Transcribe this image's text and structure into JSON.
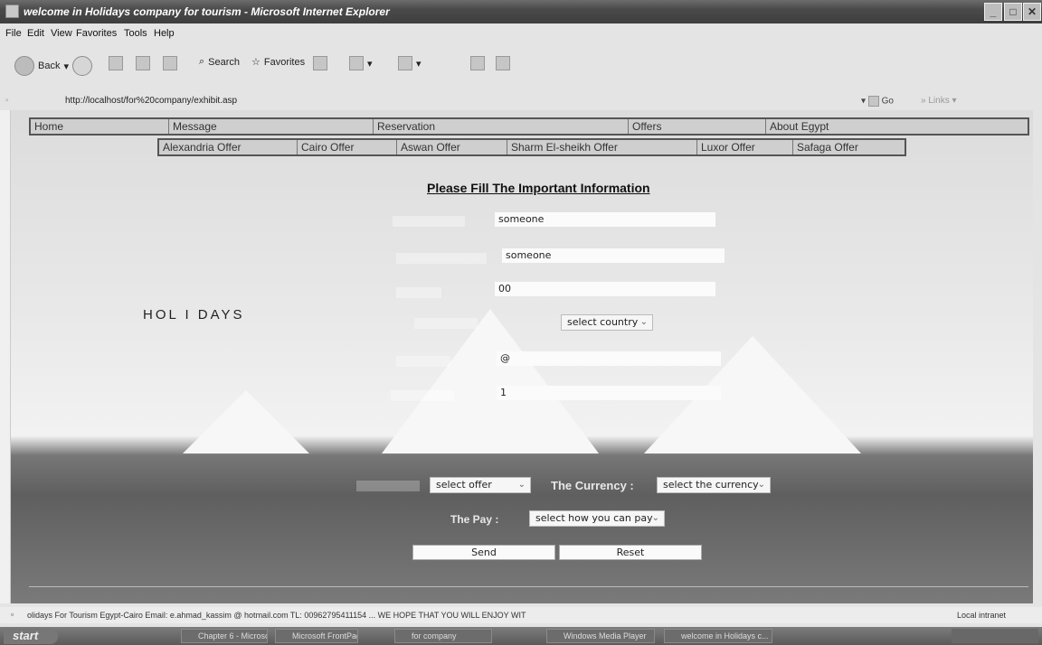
{
  "window": {
    "title": "welcome in Holidays company for tourism - Microsoft Internet Explorer"
  },
  "menu": [
    "File",
    "Edit",
    "View",
    "Favorites",
    "Tools",
    "Help"
  ],
  "toolbar": {
    "back": "Back",
    "search": "Search",
    "favorites": "Favorites"
  },
  "address": {
    "url": "http://localhost/for%20company/exhibit.asp",
    "go": "Go",
    "links": "Links"
  },
  "nav": {
    "main": [
      "Home",
      "Message",
      "Reservation",
      "Offers",
      "About Egypt"
    ],
    "offers": [
      "Alexandria Offer",
      "Cairo Offer",
      "Aswan Offer",
      "Sharm El-sheikh Offer",
      "Luxor Offer",
      "Safaga Offer"
    ]
  },
  "page": {
    "heading": "Please Fill The Important Information",
    "brand": "HOL I DAYS"
  },
  "form": {
    "name_value": "someone",
    "name2_value": "someone",
    "phone_value": "00",
    "country_select": "select country",
    "email_value": "@",
    "count_value": "1",
    "offer_select": "select offer",
    "currency_label": "The Currency :",
    "currency_select": "select the currency",
    "pay_label": "The Pay :",
    "pay_select": "select how you can pay",
    "send": "Send",
    "reset": "Reset"
  },
  "status": {
    "message": "olidays For Tourism  Egypt-Cairo  Email: e.ahmad_kassim @ hotmail.com TL: 00962795411154  ... WE HOPE THAT YOU WILL ENJOY WIT",
    "zone": "Local intranet"
  },
  "taskbar": {
    "start": "start",
    "tasks": [
      "Chapter 6 - Microsoft",
      "Microsoft FrontPage",
      "for company",
      "Windows Media Player",
      "welcome in Holidays c..."
    ]
  }
}
